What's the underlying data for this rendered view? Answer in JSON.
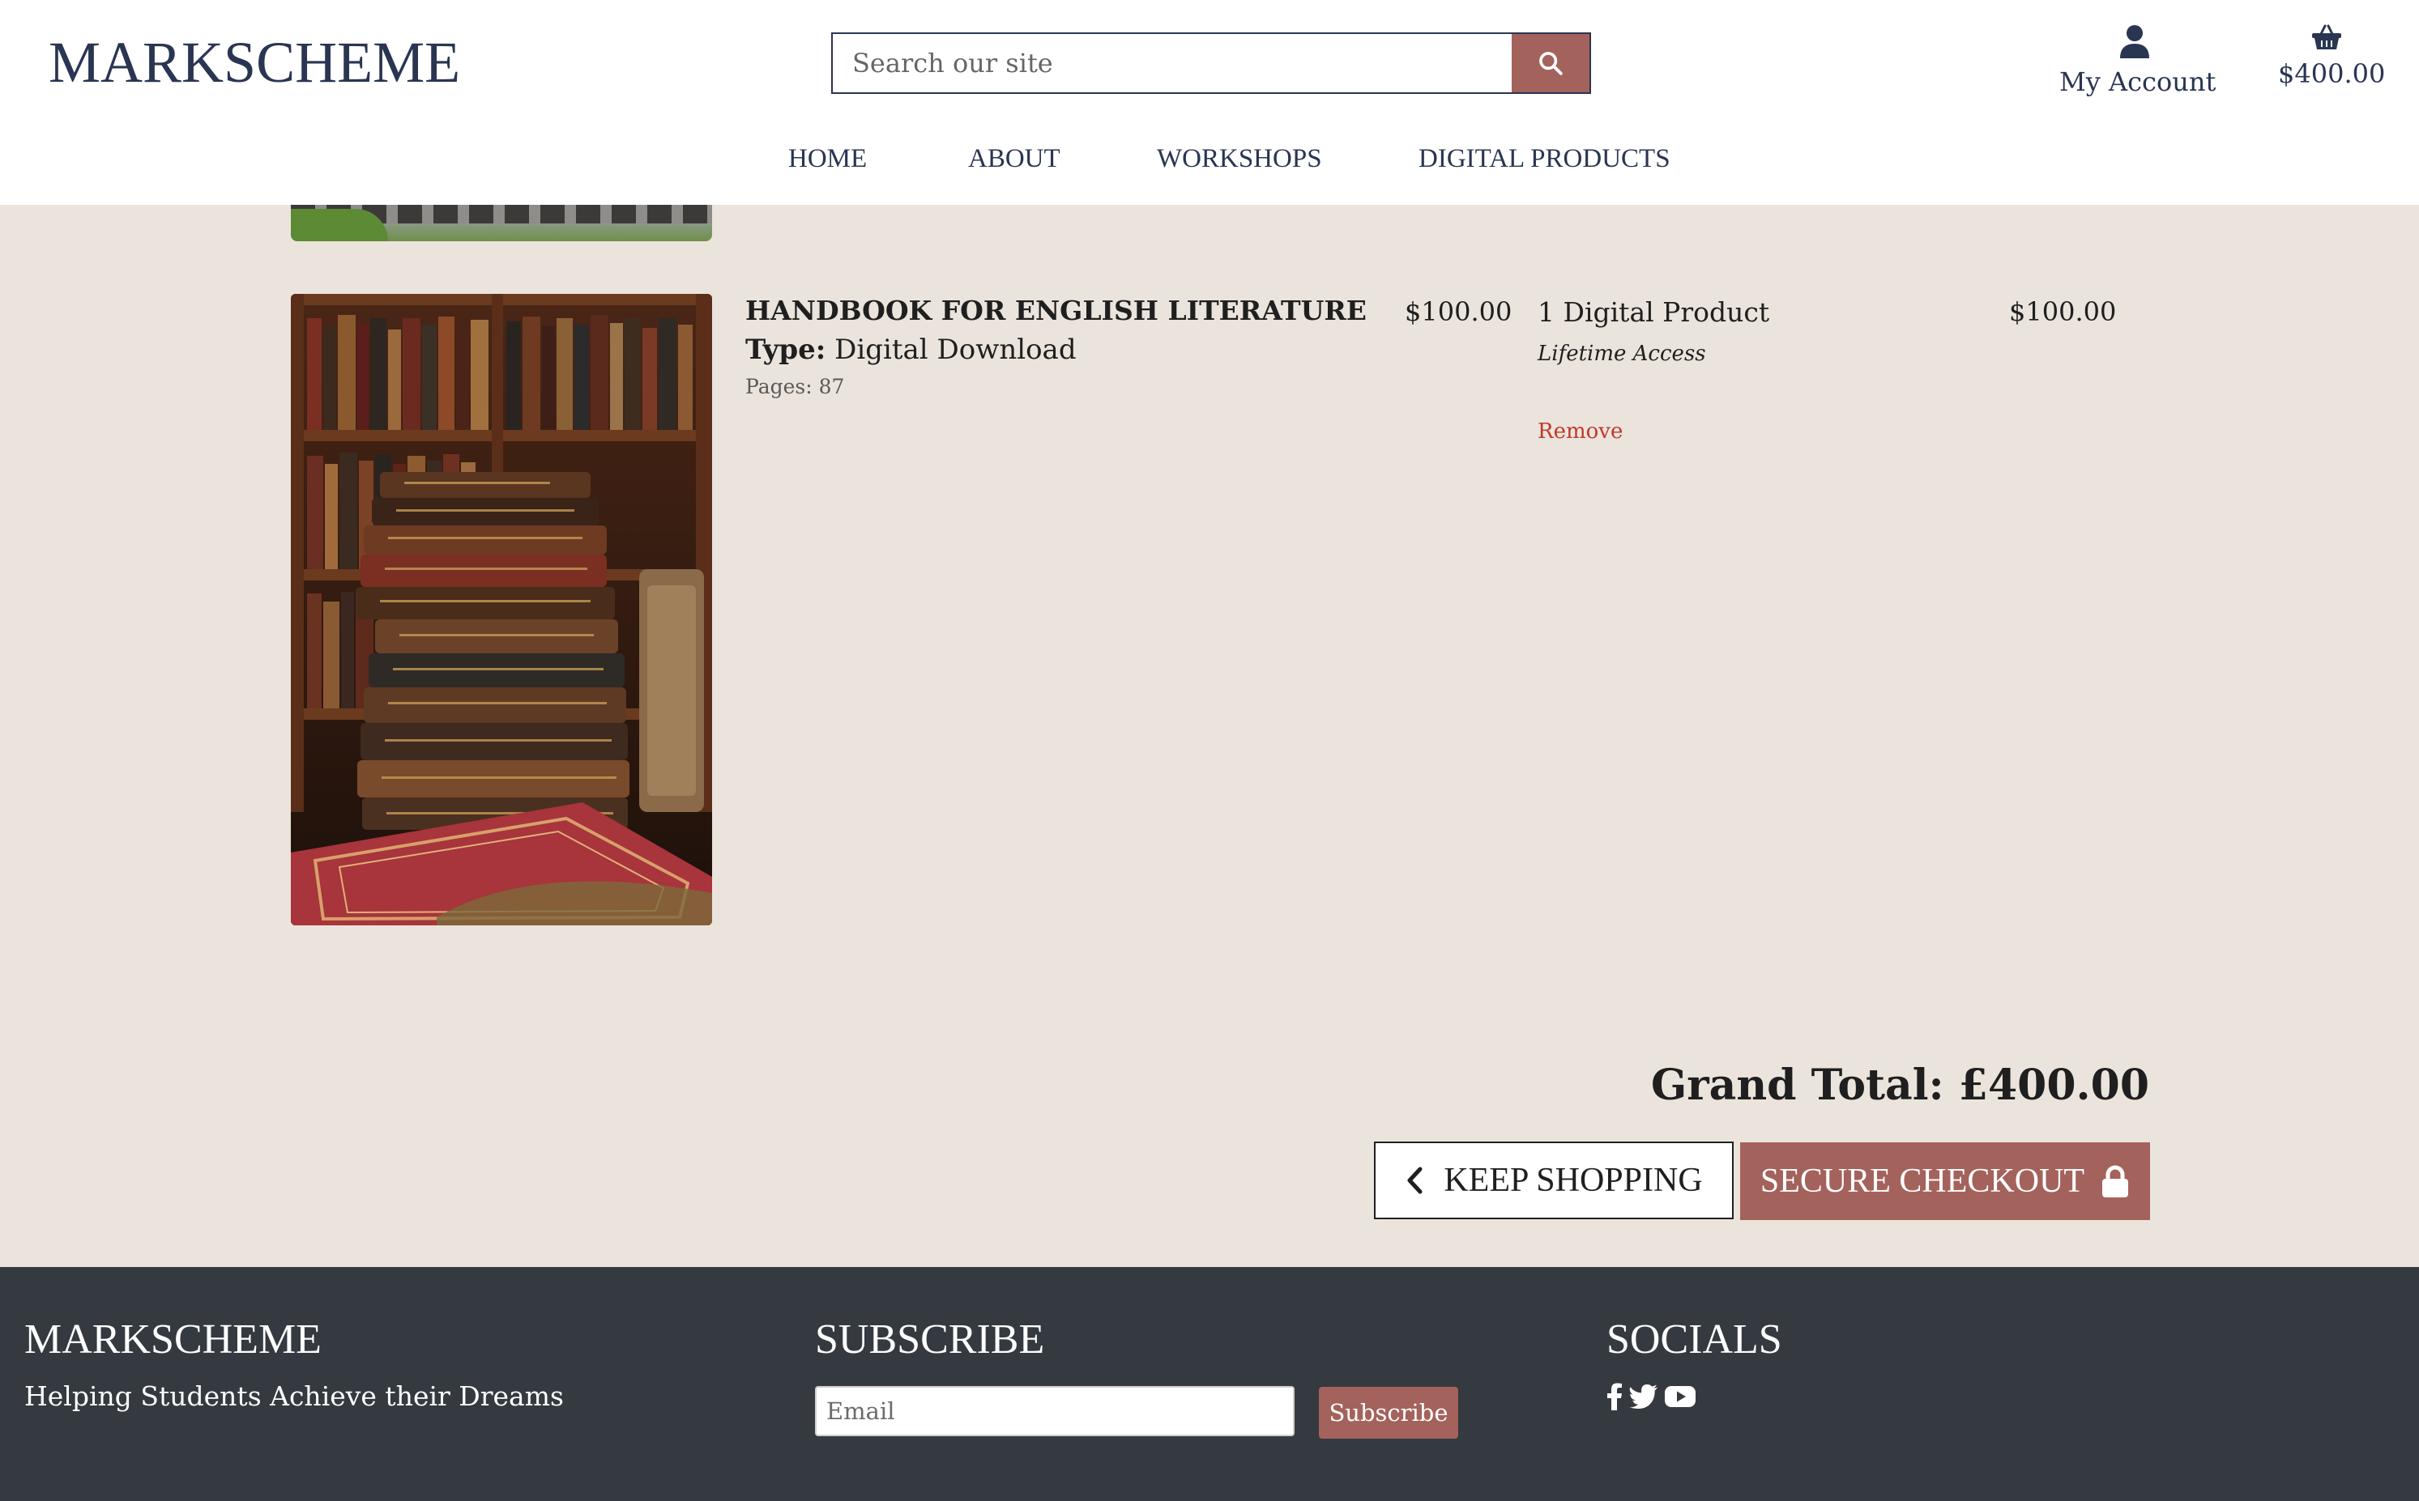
{
  "header": {
    "logo": "MARKSCHEME",
    "search_placeholder": "Search our site",
    "account_label": "My Account",
    "bag_total": "$400.00",
    "nav": [
      "HOME",
      "ABOUT",
      "WORKSHOPS",
      "DIGITAL PRODUCTS"
    ]
  },
  "cart": {
    "item": {
      "name": "HANDBOOK FOR ENGLISH LITERATURE",
      "type_label": "Type:",
      "type_value": "Digital Download",
      "pages": "Pages: 87",
      "price": "$100.00",
      "quantity": "1 Digital Product",
      "access": "Lifetime Access",
      "remove_label": "Remove",
      "subtotal": "$100.00"
    },
    "grand_total": "Grand Total: £400.00",
    "keep_shopping_label": "KEEP SHOPPING",
    "checkout_label": "SECURE CHECKOUT"
  },
  "footer": {
    "brand_title": "MARKSCHEME",
    "tagline": "Helping Students Achieve their Dreams",
    "subscribe_title": "SUBSCRIBE",
    "email_placeholder": "Email",
    "subscribe_button": "Subscribe",
    "socials_title": "SOCIALS",
    "social_icons": [
      "facebook-icon",
      "twitter-icon",
      "youtube-icon"
    ]
  },
  "colors": {
    "brand_navy": "#2a3552",
    "accent": "#a4625c",
    "page_bg": "#ebe4dc",
    "footer_bg": "#343a40",
    "remove_red": "#c0392b"
  }
}
